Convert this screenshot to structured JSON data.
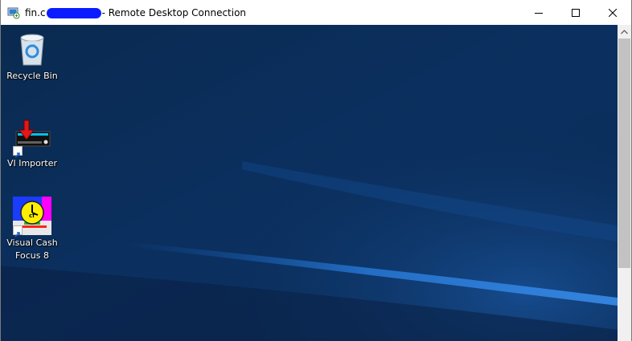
{
  "window": {
    "title_prefix": "fin.c",
    "title_suffix": "- Remote Desktop Connection"
  },
  "desktop": {
    "icons": [
      {
        "label": "Recycle Bin",
        "icon": "recycle-bin-icon"
      },
      {
        "label": "VI Importer",
        "icon": "vi-importer-icon"
      },
      {
        "label": "Visual Cash\nFocus 8",
        "icon": "visual-cash-focus-icon"
      }
    ]
  },
  "colors": {
    "desktop_bg": "#0c2f5c",
    "redaction": "#0a1cff",
    "scroll_thumb": "#c2c2c2"
  }
}
